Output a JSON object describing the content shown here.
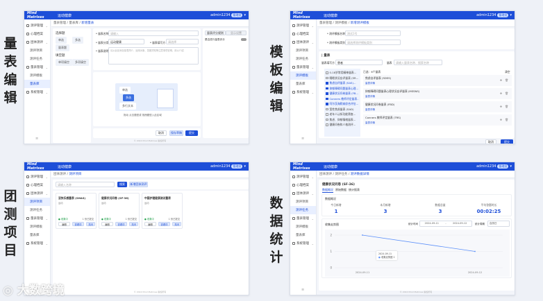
{
  "labels": [
    "量表编辑",
    "模板编辑",
    "团测项目",
    "数据统计"
  ],
  "watermark": "大数跨境",
  "app": {
    "logo": "Mind Matrixes",
    "title": "运动健康",
    "user": "admin1234",
    "badge": "管理员",
    "footer": "© 2024 Mind Matrixes 版权所有"
  },
  "sidebar": {
    "items": [
      {
        "label": "测评管理",
        "chev": "⌄"
      },
      {
        "label": "心理档案",
        "chev": ""
      },
      {
        "label": "团体测评",
        "chev": "⌄"
      },
      {
        "label": "测评项目",
        "sub": true
      },
      {
        "label": "测评任务",
        "sub": true
      },
      {
        "label": "量表管理",
        "chev": "⌄"
      },
      {
        "label": "测评模板",
        "sub": true
      },
      {
        "label": "量表库",
        "sub": true
      },
      {
        "label": "系统管理",
        "chev": "⌄"
      }
    ],
    "collapse_icon": "≡"
  },
  "scale_edit": {
    "breadcrumb": [
      "量表管理",
      "量表库",
      "新增量表"
    ],
    "palette": {
      "choice_title": "选择题",
      "choices": [
        "单选",
        "多选",
        "量表题"
      ],
      "fill_title": "填空题",
      "fills": [
        "单项填空",
        "多项填空"
      ]
    },
    "form": {
      "name_label": "* 量表名称",
      "name_placeholder": "请输入",
      "name_count": "0/50",
      "cat_label": "* 量表分类",
      "cat_value": "运动健康",
      "target_label": "* 量表填写方",
      "target_value": "请选择",
      "desc_label": "* 量表说明",
      "desc_placeholder": "请从此处添加量表简介、适用对象、答题须知等注意事项说明，用以介绍",
      "desc_count": "0/500"
    },
    "canvas": {
      "items": [
        "单选",
        "多选",
        "多行文本"
      ],
      "hint": "拖动 点击题型或 拖拽题型入此区域"
    },
    "right": {
      "tab_active": "量表评分规则",
      "tab_other": "显示设置",
      "toggle_label": "是否进行量表评分"
    },
    "buttons": {
      "cancel": "取消",
      "save_draft": "保存草稿",
      "submit": "提交"
    }
  },
  "template_edit": {
    "breadcrumb": [
      "量表管理",
      "测评模板",
      "新增测评模板"
    ],
    "form": {
      "name_label": "* 测评模板名称",
      "name_value": "测试1号",
      "cat_label": "* 测评模板类别",
      "cat_placeholder": "请选择测评模板类别"
    },
    "section": "| 量表",
    "filter": {
      "target_label": "量表填写方",
      "target_value": "患者",
      "search_label": "量表",
      "search_placeholder": "请输入量表名称、搜索名称"
    },
    "list": [
      {
        "label": "0-18岁常用精神量表...",
        "on": false
      },
      {
        "label": "睡眠状况自评量表 (SR...",
        "on": false
      },
      {
        "label": "焦虑自评量表 (SAS)...",
        "on": true
      },
      {
        "label": "抑郁障碍问题量表心理...",
        "on": true
      },
      {
        "label": "健康状况问卷量表 (FB...",
        "on": true
      },
      {
        "label": "Conners 教师评定量表...",
        "on": true
      },
      {
        "label": "阿尔茨海默病综合评估...",
        "on": true
      },
      {
        "label": "宽性焦虑量表 (SAD)",
        "on": false
      },
      {
        "label": "老年人认知功能筛查...",
        "on": false
      },
      {
        "label": "焦虑、抑郁情绪量表...",
        "on": false
      },
      {
        "label": "健康问卷和人格测评...",
        "on": false
      }
    ],
    "selected_title": "已选：6个量表",
    "clear": "清空",
    "selected": [
      {
        "name": "焦虑自评量表 (SDSS)",
        "link": "量表详情"
      },
      {
        "name": "抑郁障碍问题量表心理状况自评量表 (MSSNS)",
        "link": "量表详情"
      },
      {
        "name": "健康状况问卷量表 (FBD)",
        "link": "量表详情"
      },
      {
        "name": "Conners 教师评定量表 (TRS)",
        "link": "量表详情"
      }
    ],
    "buttons": {
      "cancel": "取消",
      "submit": "提交"
    }
  },
  "group_project": {
    "breadcrumb": [
      "团体测评",
      "测评项目"
    ],
    "search_placeholder": "请输入名称",
    "search_btn": "搜索",
    "new_btn": "新增团体测评",
    "cards": [
      {
        "title": "亚快乐感量表 (SHAS)",
        "tag": "运动",
        "status": "● 收集中",
        "count": "1 份已提交",
        "actions": [
          "编辑",
          "查看详",
          "关闭"
        ]
      },
      {
        "title": "健康状况问卷 (SF-36)",
        "tag": "运动",
        "status": "● 收集中",
        "count": "1 份已提交",
        "actions": [
          "编辑",
          "查看详",
          "关闭"
        ]
      },
      {
        "title": "中国护理健康测试量表",
        "tag": "运动",
        "status": "● 收集中",
        "count": "1 份已提交",
        "actions": [
          "编辑",
          "查看详",
          "关闭"
        ]
      }
    ]
  },
  "stats": {
    "breadcrumb": [
      "团体测评",
      "测评任务",
      "测评数据详情"
    ],
    "title": "健康状况问卷 (SF-36)",
    "tabs": [
      "数据概况",
      "原始数据",
      "统计报表"
    ],
    "overview_title": "数据概况",
    "kpis": [
      {
        "label": "今日新增",
        "value": "1"
      },
      {
        "label": "本月新增",
        "value": "3"
      },
      {
        "label": "数据总量",
        "value": "3"
      },
      {
        "label": "平均答题时长",
        "value": "00:02:25"
      }
    ],
    "trend_title": "收集走势图",
    "range_label": "统计时间",
    "date_from": "2024-09-11",
    "date_sep": "-",
    "date_to": "2024-09-12",
    "period_label": "统计周期",
    "period_value": "自然日",
    "tooltip": {
      "date": "2024-09-11",
      "series": "收集走势图",
      "value": "2"
    }
  },
  "chart_data": {
    "type": "line",
    "x": [
      "2024-09-11",
      "2024-09-12"
    ],
    "series": [
      {
        "name": "收集走势图",
        "values": [
          2,
          1
        ]
      }
    ],
    "ylim": [
      0,
      2
    ],
    "yticks": [
      "0",
      "1",
      "2"
    ],
    "color": "#5b8ff9",
    "grid": true
  }
}
